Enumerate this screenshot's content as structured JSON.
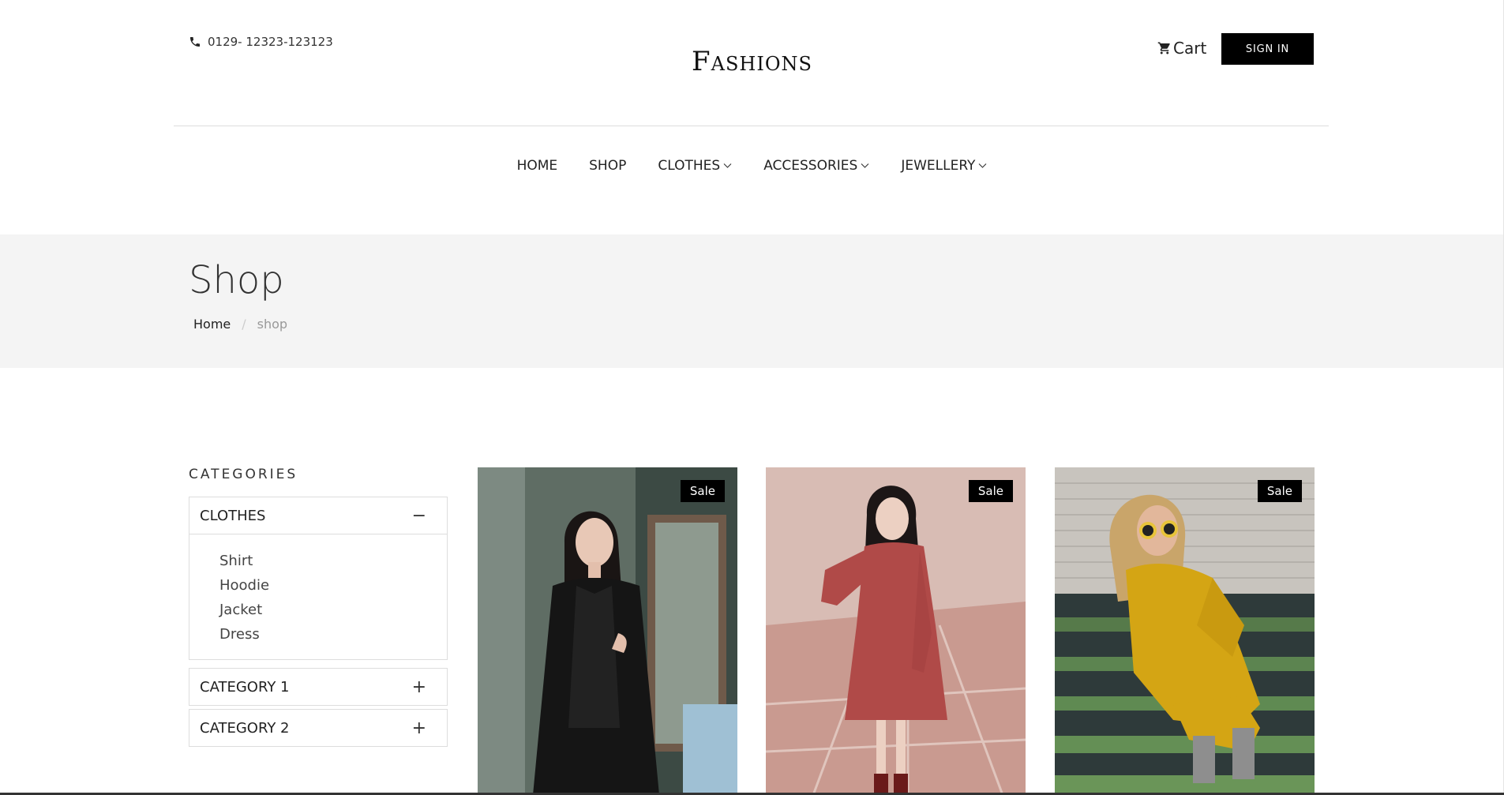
{
  "header": {
    "phone": "0129- 12323-123123",
    "logo": "Fashions",
    "cart_label": "Cart",
    "signin_label": "SIGN IN"
  },
  "nav": {
    "items": [
      {
        "label": "HOME",
        "dropdown": false
      },
      {
        "label": "SHOP",
        "dropdown": false
      },
      {
        "label": "CLOTHES",
        "dropdown": true
      },
      {
        "label": "ACCESSORIES",
        "dropdown": true
      },
      {
        "label": "JEWELLERY",
        "dropdown": true
      }
    ]
  },
  "banner": {
    "title": "Shop",
    "breadcrumb": {
      "home": "Home",
      "separator": "/",
      "current": "shop"
    }
  },
  "sidebar": {
    "title": "CATEGORIES",
    "groups": [
      {
        "label": "CLOTHES",
        "toggle": "−",
        "expanded": true,
        "items": [
          "Shirt",
          "Hoodie",
          "Jacket",
          "Dress"
        ]
      },
      {
        "label": "CATEGORY 1",
        "toggle": "+",
        "expanded": false
      },
      {
        "label": "CATEGORY 2",
        "toggle": "+",
        "expanded": false
      }
    ]
  },
  "products": [
    {
      "badge": "Sale",
      "image": "woman-black-dress"
    },
    {
      "badge": "Sale",
      "image": "woman-red-floral-dress"
    },
    {
      "badge": "Sale",
      "image": "woman-yellow-knit-dress"
    }
  ],
  "colors": {
    "accent": "#000000",
    "banner_bg": "#f4f4f4",
    "text": "#222222"
  }
}
